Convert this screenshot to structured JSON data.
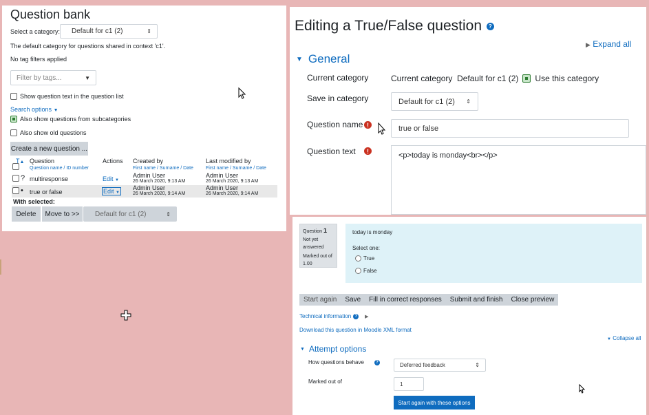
{
  "question_bank": {
    "title": "Question bank",
    "category_label": "Select a category:",
    "category_value": "Default for c1 (2)",
    "category_desc": "The default category for questions shared in context 'c1'.",
    "no_tag_filters": "No tag filters applied",
    "filter_placeholder": "Filter by tags...",
    "show_question_text": "Show question text in the question list",
    "search_options": "Search options",
    "also_show_subcategories": "Also show questions from subcategories",
    "also_show_old": "Also show old questions",
    "create_button": "Create a new question ...",
    "table": {
      "col_t": "T",
      "col_question": "Question",
      "col_question_sub1": "Question name",
      "col_question_sub2": "ID number",
      "col_actions": "Actions",
      "col_created": "Created by",
      "col_modified": "Last modified by",
      "sub_first": "First name",
      "sub_surname": "Surname",
      "sub_date": "Date",
      "rows": [
        {
          "type_icon": "?",
          "name": "multiresponse",
          "action": "Edit",
          "created_by": "Admin User",
          "created_date": "26 March 2020, 9:13 AM",
          "modified_by": "Admin User",
          "modified_date": "26 March 2020, 9:13 AM"
        },
        {
          "type_icon": "•",
          "name": "true or false",
          "action": "Edit",
          "created_by": "Admin User",
          "created_date": "26 March 2020, 9:14 AM",
          "modified_by": "Admin User",
          "modified_date": "26 March 2020, 9:14 AM"
        }
      ]
    },
    "with_selected": "With selected:",
    "delete_button": "Delete",
    "move_button": "Move to >>",
    "move_target": "Default for c1 (2)"
  },
  "edit": {
    "title": "Editing a True/False question",
    "expand_all": "Expand all",
    "general": "General",
    "current_category_label": "Current category",
    "current_category_value": "Current category  Default for c1 (2)",
    "use_this_category": "Use this category",
    "save_in_category_label": "Save in category",
    "save_in_category_value": "Default for c1 (2)",
    "question_name_label": "Question name",
    "question_name_value": "true or false",
    "question_text_label": "Question text",
    "question_text_value": "<p>today is monday<br></p>"
  },
  "preview": {
    "question_label": "Question",
    "question_number": "1",
    "state": "Not yet answered",
    "marked_out_of": "Marked out of 1.00",
    "question_text": "today is monday",
    "select_one": "Select one:",
    "option_true": "True",
    "option_false": "False",
    "buttons": [
      "Start again",
      "Save",
      "Fill in correct responses",
      "Submit and finish",
      "Close preview"
    ],
    "technical_information": "Technical information",
    "download_xml": "Download this question in Moodle XML format",
    "collapse_all": "Collapse all",
    "attempt_options": "Attempt options",
    "how_behave_label": "How questions behave",
    "how_behave_value": "Deferred feedback",
    "marked_out_of_label": "Marked out of",
    "marked_out_of_value": "1",
    "start_again_options": "Start again with these options"
  },
  "colors": {
    "background": "#e8b6b6",
    "link": "#0f6cbf",
    "required": "#ca3120",
    "formulation_bg": "#def2f8",
    "info_bg": "#dee2e6"
  }
}
